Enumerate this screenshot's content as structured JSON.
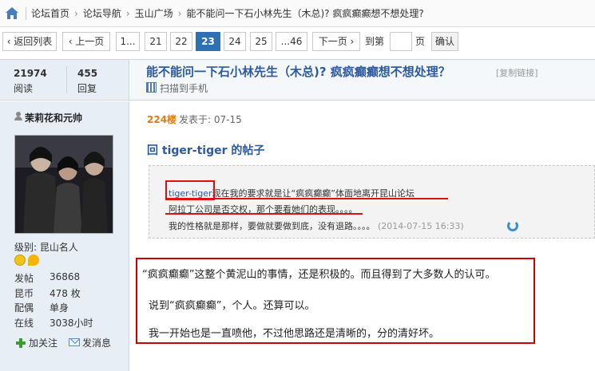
{
  "breadcrumb": {
    "items": [
      "论坛首页",
      "论坛导航",
      "玉山广场",
      "能不能问一下石小林先生（木总)? 疯疯癫癫想不想处理?"
    ],
    "separator": "›"
  },
  "pager": {
    "back_label": "‹ 返回列表",
    "prev_label": "‹ 上一页",
    "pages": [
      "1...",
      "21",
      "22",
      "23",
      "24",
      "25",
      "...46"
    ],
    "current_page": "23",
    "next_label": "下一页 ›",
    "goto_label": "到第",
    "page_suffix": "页",
    "goto_value": "",
    "confirm_label": "确认"
  },
  "stats": {
    "views": "21974",
    "views_label": "阅读",
    "replies": "455",
    "replies_label": "回复"
  },
  "thread": {
    "title": "能不能问一下石小林先生（木总)? 疯疯癫癫想不想处理？",
    "copy_link": "[复制链接]",
    "scan_to_phone": "扫描到手机"
  },
  "author": {
    "name": "茉莉花和元帅",
    "level": "级别: 昆山名人",
    "stats": [
      {
        "label": "发帖",
        "value": "36868"
      },
      {
        "label": "昆币",
        "value": "478 枚"
      },
      {
        "label": "配偶",
        "value": "单身"
      },
      {
        "label": "在线",
        "value": "3038小时"
      }
    ],
    "follow_label": "加关注",
    "message_label": "发消息"
  },
  "post": {
    "floor": "224楼",
    "posted_at": "发表于: 07-15",
    "reply_to": "回 tiger-tiger 的帖子",
    "quote": {
      "author": "tiger-tiger",
      "line1": "现在我的要求就是让“疯疯癫癫”体面地离开昆山论坛",
      "line2": "阿拉丁公司是否交权，那个要看她们的表现。。。。",
      "line3": "我的性格就是那样，要做就要做到底，没有退路。。。。",
      "time": "(2014-07-15 16:33)"
    },
    "body": [
      "“疯疯癫癫”这整个黄泥山的事情，还是积极的。而且得到了大多数人的认可。",
      "说到“疯疯癫癫”，个人。还算可以。",
      "我一开始也是一直喷他，不过他思路还是清晰的，分的清好坏。"
    ]
  },
  "colors": {
    "accent_blue": "#2b5aa0",
    "current_page_bg": "#2f6fb4",
    "floor_orange": "#e07b10",
    "highlight_red": "#d11111",
    "panel_bg": "#e8eef5"
  }
}
